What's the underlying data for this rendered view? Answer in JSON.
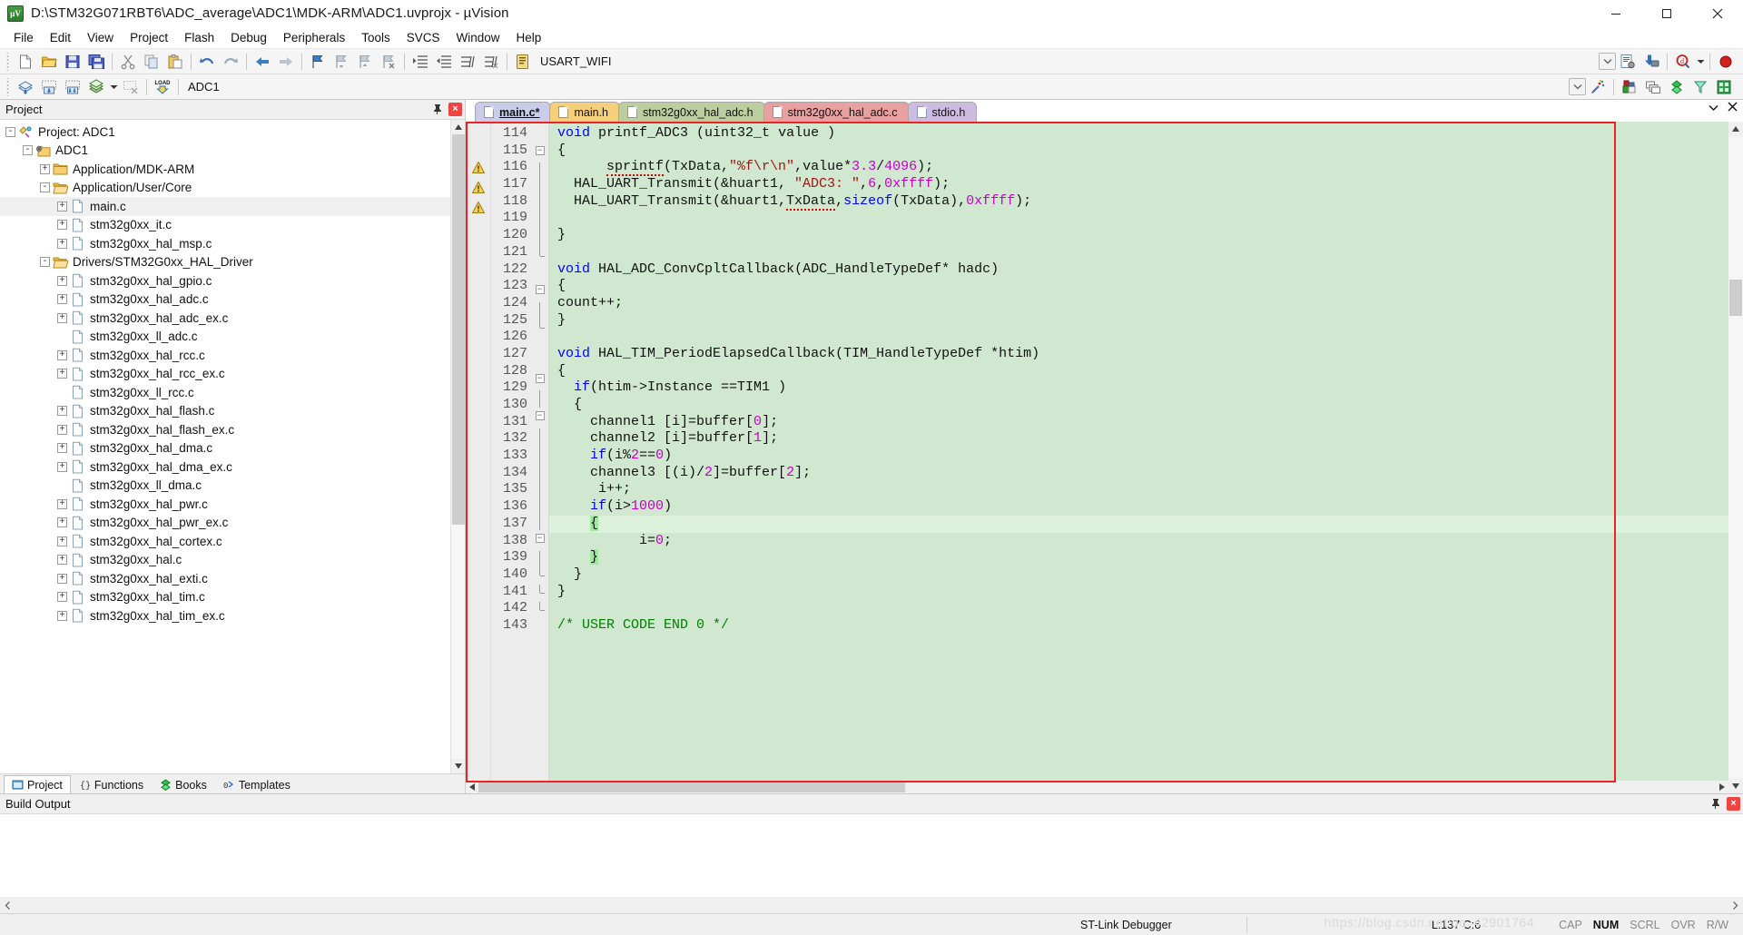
{
  "window": {
    "title": "D:\\STM32G071RBT6\\ADC_average\\ADC1\\MDK-ARM\\ADC1.uvprojx - µVision",
    "app_icon": "uvision-icon",
    "minimize": "minimize-button",
    "maximize": "maximize-button",
    "close": "close-button"
  },
  "menubar": {
    "items": [
      "File",
      "Edit",
      "View",
      "Project",
      "Flash",
      "Debug",
      "Peripherals",
      "Tools",
      "SVCS",
      "Window",
      "Help"
    ]
  },
  "toolbar1": {
    "icons": [
      "new-file-icon",
      "open-file-icon",
      "save-icon",
      "save-all-icon",
      "cut-icon",
      "copy-icon",
      "paste-icon",
      "undo-icon",
      "redo-icon",
      "navigate-back-icon",
      "navigate-forward-icon",
      "bookmark-toggle-icon",
      "bookmark-prev-icon",
      "bookmark-next-icon",
      "bookmark-clear-icon",
      "indent-icon",
      "outdent-icon",
      "comment-icon",
      "uncomment-icon",
      "target-options-icon"
    ],
    "target_value": "USART_WIFI",
    "right_icons": [
      "combo-dropdown-icon",
      "build-target-icon",
      "download-icon",
      "debug-session-icon",
      "debug-dropdown-icon",
      "record-icon"
    ]
  },
  "toolbar2": {
    "icons": [
      "translate-icon",
      "build-icon",
      "rebuild-icon",
      "batch-build-icon",
      "batch-dropdown-icon",
      "stop-build-icon",
      "load-icon"
    ],
    "project_value": "ADC1",
    "right_icons": [
      "combo-dropdown-icon",
      "manage-run-time-icon",
      "target-options-icon",
      "multi-project-icon",
      "books-icon",
      "functions-icon",
      "templates-icon"
    ]
  },
  "project_panel": {
    "title": "Project",
    "pin": "pin-icon",
    "close": "close-icon",
    "tree": [
      {
        "depth": 0,
        "expander": "-",
        "icon": "project-icon",
        "label": "Project: ADC1",
        "selected": false
      },
      {
        "depth": 1,
        "expander": "-",
        "icon": "target-icon",
        "label": "ADC1",
        "selected": false
      },
      {
        "depth": 2,
        "expander": "+",
        "icon": "folder-closed-icon",
        "label": "Application/MDK-ARM",
        "selected": false
      },
      {
        "depth": 2,
        "expander": "-",
        "icon": "folder-open-icon",
        "label": "Application/User/Core",
        "selected": false
      },
      {
        "depth": 3,
        "expander": "+",
        "icon": "file-icon",
        "label": "main.c",
        "selected": true
      },
      {
        "depth": 3,
        "expander": "+",
        "icon": "file-icon",
        "label": "stm32g0xx_it.c",
        "selected": false
      },
      {
        "depth": 3,
        "expander": "+",
        "icon": "file-icon",
        "label": "stm32g0xx_hal_msp.c",
        "selected": false
      },
      {
        "depth": 2,
        "expander": "-",
        "icon": "folder-open-icon",
        "label": "Drivers/STM32G0xx_HAL_Driver",
        "selected": false
      },
      {
        "depth": 3,
        "expander": "+",
        "icon": "file-icon",
        "label": "stm32g0xx_hal_gpio.c",
        "selected": false
      },
      {
        "depth": 3,
        "expander": "+",
        "icon": "file-icon",
        "label": "stm32g0xx_hal_adc.c",
        "selected": false
      },
      {
        "depth": 3,
        "expander": "+",
        "icon": "file-icon",
        "label": "stm32g0xx_hal_adc_ex.c",
        "selected": false
      },
      {
        "depth": 3,
        "expander": "",
        "icon": "file-icon",
        "label": "stm32g0xx_ll_adc.c",
        "selected": false
      },
      {
        "depth": 3,
        "expander": "+",
        "icon": "file-icon",
        "label": "stm32g0xx_hal_rcc.c",
        "selected": false
      },
      {
        "depth": 3,
        "expander": "+",
        "icon": "file-icon",
        "label": "stm32g0xx_hal_rcc_ex.c",
        "selected": false
      },
      {
        "depth": 3,
        "expander": "",
        "icon": "file-icon",
        "label": "stm32g0xx_ll_rcc.c",
        "selected": false
      },
      {
        "depth": 3,
        "expander": "+",
        "icon": "file-icon",
        "label": "stm32g0xx_hal_flash.c",
        "selected": false
      },
      {
        "depth": 3,
        "expander": "+",
        "icon": "file-icon",
        "label": "stm32g0xx_hal_flash_ex.c",
        "selected": false
      },
      {
        "depth": 3,
        "expander": "+",
        "icon": "file-icon",
        "label": "stm32g0xx_hal_dma.c",
        "selected": false
      },
      {
        "depth": 3,
        "expander": "+",
        "icon": "file-icon",
        "label": "stm32g0xx_hal_dma_ex.c",
        "selected": false
      },
      {
        "depth": 3,
        "expander": "",
        "icon": "file-icon",
        "label": "stm32g0xx_ll_dma.c",
        "selected": false
      },
      {
        "depth": 3,
        "expander": "+",
        "icon": "file-icon",
        "label": "stm32g0xx_hal_pwr.c",
        "selected": false
      },
      {
        "depth": 3,
        "expander": "+",
        "icon": "file-icon",
        "label": "stm32g0xx_hal_pwr_ex.c",
        "selected": false
      },
      {
        "depth": 3,
        "expander": "+",
        "icon": "file-icon",
        "label": "stm32g0xx_hal_cortex.c",
        "selected": false
      },
      {
        "depth": 3,
        "expander": "+",
        "icon": "file-icon",
        "label": "stm32g0xx_hal.c",
        "selected": false
      },
      {
        "depth": 3,
        "expander": "+",
        "icon": "file-icon",
        "label": "stm32g0xx_hal_exti.c",
        "selected": false
      },
      {
        "depth": 3,
        "expander": "+",
        "icon": "file-icon",
        "label": "stm32g0xx_hal_tim.c",
        "selected": false
      },
      {
        "depth": 3,
        "expander": "+",
        "icon": "file-icon",
        "label": "stm32g0xx_hal_tim_ex.c",
        "selected": false
      }
    ],
    "bottom_tabs": [
      {
        "label": "Project",
        "icon": "project-tab-icon",
        "active": true
      },
      {
        "label": "Functions",
        "icon": "functions-tab-icon",
        "active": false
      },
      {
        "label": "Books",
        "icon": "books-tab-icon",
        "active": false
      },
      {
        "label": "Templates",
        "icon": "templates-tab-icon",
        "active": false
      }
    ]
  },
  "editor": {
    "tabs": [
      {
        "label": "main.c*",
        "active": true,
        "color": "#c9cdea"
      },
      {
        "label": "main.h",
        "active": false,
        "color": "#f5cf7a"
      },
      {
        "label": "stm32g0xx_hal_adc.h",
        "active": false,
        "color": "#bccda0"
      },
      {
        "label": "stm32g0xx_hal_adc.c",
        "active": false,
        "color": "#e8a0a0"
      },
      {
        "label": "stdio.h",
        "active": false,
        "color": "#cdbbe0"
      }
    ],
    "tab_menu_icon": "chevron-down-icon",
    "tab_close_icon": "close-icon",
    "first_line": 114,
    "lines": [
      {
        "n": 114,
        "warn": false,
        "fold": "-",
        "hl": false,
        "tokens": [
          {
            "t": "void ",
            "c": "kw"
          },
          {
            "t": "printf_ADC3 (uint32_t value )",
            "c": ""
          }
        ]
      },
      {
        "n": 115,
        "warn": false,
        "fold": "box-minus",
        "hl": false,
        "tokens": [
          {
            "t": "{",
            "c": ""
          }
        ]
      },
      {
        "n": 116,
        "warn": true,
        "fold": "|",
        "hl": false,
        "tokens": [
          {
            "t": "      ",
            "c": ""
          },
          {
            "t": "sprintf",
            "c": "spell"
          },
          {
            "t": "(TxData,",
            "c": ""
          },
          {
            "t": "\"%f\\r\\n\"",
            "c": "str"
          },
          {
            "t": ",value*",
            "c": ""
          },
          {
            "t": "3.3",
            "c": "num"
          },
          {
            "t": "/",
            "c": ""
          },
          {
            "t": "4096",
            "c": "num"
          },
          {
            "t": ");",
            "c": ""
          }
        ]
      },
      {
        "n": 117,
        "warn": true,
        "fold": "|",
        "hl": false,
        "tokens": [
          {
            "t": "  HAL_UART_Transmit(&huart1, ",
            "c": ""
          },
          {
            "t": "\"ADC3: \"",
            "c": "str"
          },
          {
            "t": ",",
            "c": ""
          },
          {
            "t": "6",
            "c": "num"
          },
          {
            "t": ",",
            "c": ""
          },
          {
            "t": "0xffff",
            "c": "num"
          },
          {
            "t": ");",
            "c": ""
          }
        ]
      },
      {
        "n": 118,
        "warn": true,
        "fold": "|",
        "hl": false,
        "tokens": [
          {
            "t": "  HAL_UART_Transmit(&huart1,",
            "c": ""
          },
          {
            "t": "TxData",
            "c": "spell"
          },
          {
            "t": ",",
            "c": ""
          },
          {
            "t": "sizeof",
            "c": "kw"
          },
          {
            "t": "(TxData),",
            "c": ""
          },
          {
            "t": "0xffff",
            "c": "num"
          },
          {
            "t": ");",
            "c": ""
          }
        ]
      },
      {
        "n": 119,
        "warn": false,
        "fold": "|",
        "hl": false,
        "tokens": []
      },
      {
        "n": 120,
        "warn": false,
        "fold": "|",
        "hl": false,
        "tokens": [
          {
            "t": "}",
            "c": ""
          }
        ]
      },
      {
        "n": 121,
        "warn": false,
        "fold": "end",
        "hl": false,
        "tokens": []
      },
      {
        "n": 122,
        "warn": false,
        "fold": "",
        "hl": false,
        "tokens": [
          {
            "t": "void ",
            "c": "kw"
          },
          {
            "t": "HAL_ADC_ConvCpltCallback(ADC_HandleTypeDef* hadc)",
            "c": ""
          }
        ]
      },
      {
        "n": 123,
        "warn": false,
        "fold": "box-minus",
        "hl": false,
        "tokens": [
          {
            "t": "{",
            "c": ""
          }
        ]
      },
      {
        "n": 124,
        "warn": false,
        "fold": "|",
        "hl": false,
        "tokens": [
          {
            "t": "count++;",
            "c": ""
          }
        ]
      },
      {
        "n": 125,
        "warn": false,
        "fold": "end",
        "hl": false,
        "tokens": [
          {
            "t": "}",
            "c": ""
          }
        ]
      },
      {
        "n": 126,
        "warn": false,
        "fold": "",
        "hl": false,
        "tokens": []
      },
      {
        "n": 127,
        "warn": false,
        "fold": "",
        "hl": false,
        "tokens": [
          {
            "t": "void ",
            "c": "kw"
          },
          {
            "t": "HAL_TIM_PeriodElapsedCallback(TIM_HandleTypeDef *htim)",
            "c": ""
          }
        ]
      },
      {
        "n": 128,
        "warn": false,
        "fold": "box-minus",
        "hl": false,
        "tokens": [
          {
            "t": "{",
            "c": ""
          }
        ]
      },
      {
        "n": 129,
        "warn": false,
        "fold": "|",
        "hl": false,
        "tokens": [
          {
            "t": "  ",
            "c": ""
          },
          {
            "t": "if",
            "c": "kw"
          },
          {
            "t": "(htim->Instance ==TIM1 )",
            "c": ""
          }
        ]
      },
      {
        "n": 130,
        "warn": false,
        "fold": "box-minus",
        "hl": false,
        "tokens": [
          {
            "t": "  {",
            "c": ""
          }
        ]
      },
      {
        "n": 131,
        "warn": false,
        "fold": "|",
        "hl": false,
        "tokens": [
          {
            "t": "    channel1 [i]=buffer[",
            "c": ""
          },
          {
            "t": "0",
            "c": "num"
          },
          {
            "t": "];",
            "c": ""
          }
        ]
      },
      {
        "n": 132,
        "warn": false,
        "fold": "|",
        "hl": false,
        "tokens": [
          {
            "t": "    channel2 [i]=buffer[",
            "c": ""
          },
          {
            "t": "1",
            "c": "num"
          },
          {
            "t": "];",
            "c": ""
          }
        ]
      },
      {
        "n": 133,
        "warn": false,
        "fold": "|",
        "hl": false,
        "tokens": [
          {
            "t": "    ",
            "c": ""
          },
          {
            "t": "if",
            "c": "kw"
          },
          {
            "t": "(i%",
            "c": ""
          },
          {
            "t": "2",
            "c": "num"
          },
          {
            "t": "==",
            "c": ""
          },
          {
            "t": "0",
            "c": "num"
          },
          {
            "t": ")",
            "c": ""
          }
        ]
      },
      {
        "n": 134,
        "warn": false,
        "fold": "|",
        "hl": false,
        "tokens": [
          {
            "t": "    channel3 [(i)/",
            "c": ""
          },
          {
            "t": "2",
            "c": "num"
          },
          {
            "t": "]=buffer[",
            "c": ""
          },
          {
            "t": "2",
            "c": "num"
          },
          {
            "t": "];",
            "c": ""
          }
        ]
      },
      {
        "n": 135,
        "warn": false,
        "fold": "|",
        "hl": false,
        "tokens": [
          {
            "t": "     i++;",
            "c": ""
          }
        ]
      },
      {
        "n": 136,
        "warn": false,
        "fold": "|",
        "hl": false,
        "tokens": [
          {
            "t": "    ",
            "c": ""
          },
          {
            "t": "if",
            "c": "kw"
          },
          {
            "t": "(i>",
            "c": ""
          },
          {
            "t": "1000",
            "c": "num"
          },
          {
            "t": ")",
            "c": ""
          }
        ]
      },
      {
        "n": 137,
        "warn": false,
        "fold": "box-minus",
        "hl": true,
        "tokens": [
          {
            "t": "    ",
            "c": ""
          },
          {
            "t": "{",
            "c": "brace-hl"
          }
        ]
      },
      {
        "n": 138,
        "warn": false,
        "fold": "|",
        "hl": false,
        "tokens": [
          {
            "t": "          i=",
            "c": ""
          },
          {
            "t": "0",
            "c": "num"
          },
          {
            "t": ";",
            "c": ""
          }
        ]
      },
      {
        "n": 139,
        "warn": false,
        "fold": "end",
        "hl": false,
        "tokens": [
          {
            "t": "    ",
            "c": ""
          },
          {
            "t": "}",
            "c": "brace-hl"
          }
        ]
      },
      {
        "n": 140,
        "warn": false,
        "fold": "end",
        "hl": false,
        "tokens": [
          {
            "t": "  }",
            "c": ""
          }
        ]
      },
      {
        "n": 141,
        "warn": false,
        "fold": "end",
        "hl": false,
        "tokens": [
          {
            "t": "}",
            "c": ""
          }
        ]
      },
      {
        "n": 142,
        "warn": false,
        "fold": "",
        "hl": false,
        "tokens": []
      },
      {
        "n": 143,
        "warn": false,
        "fold": "",
        "hl": false,
        "tokens": [
          {
            "t": "/* USER CODE END 0 */",
            "c": "cmt"
          }
        ]
      }
    ]
  },
  "build_output": {
    "title": "Build Output",
    "pin": "pin-icon",
    "close": "close-icon",
    "text": ""
  },
  "statusbar": {
    "debugger": "ST-Link Debugger",
    "cursor": "L:137 C:6",
    "flags": [
      {
        "label": "CAP",
        "on": false
      },
      {
        "label": "NUM",
        "on": true
      },
      {
        "label": "SCRL",
        "on": false
      },
      {
        "label": "OVR",
        "on": false
      },
      {
        "label": "R/W",
        "on": false
      }
    ],
    "watermark": "https://blog.csdn.net/qq_42901764"
  },
  "colors": {
    "code_bg": "#cfe8cf",
    "highlight_line": "#ddf2dd",
    "red_box": "#ee2222",
    "keyword": "#0000ff",
    "string": "#a31515",
    "number": "#c800c8",
    "comment": "#008000"
  }
}
